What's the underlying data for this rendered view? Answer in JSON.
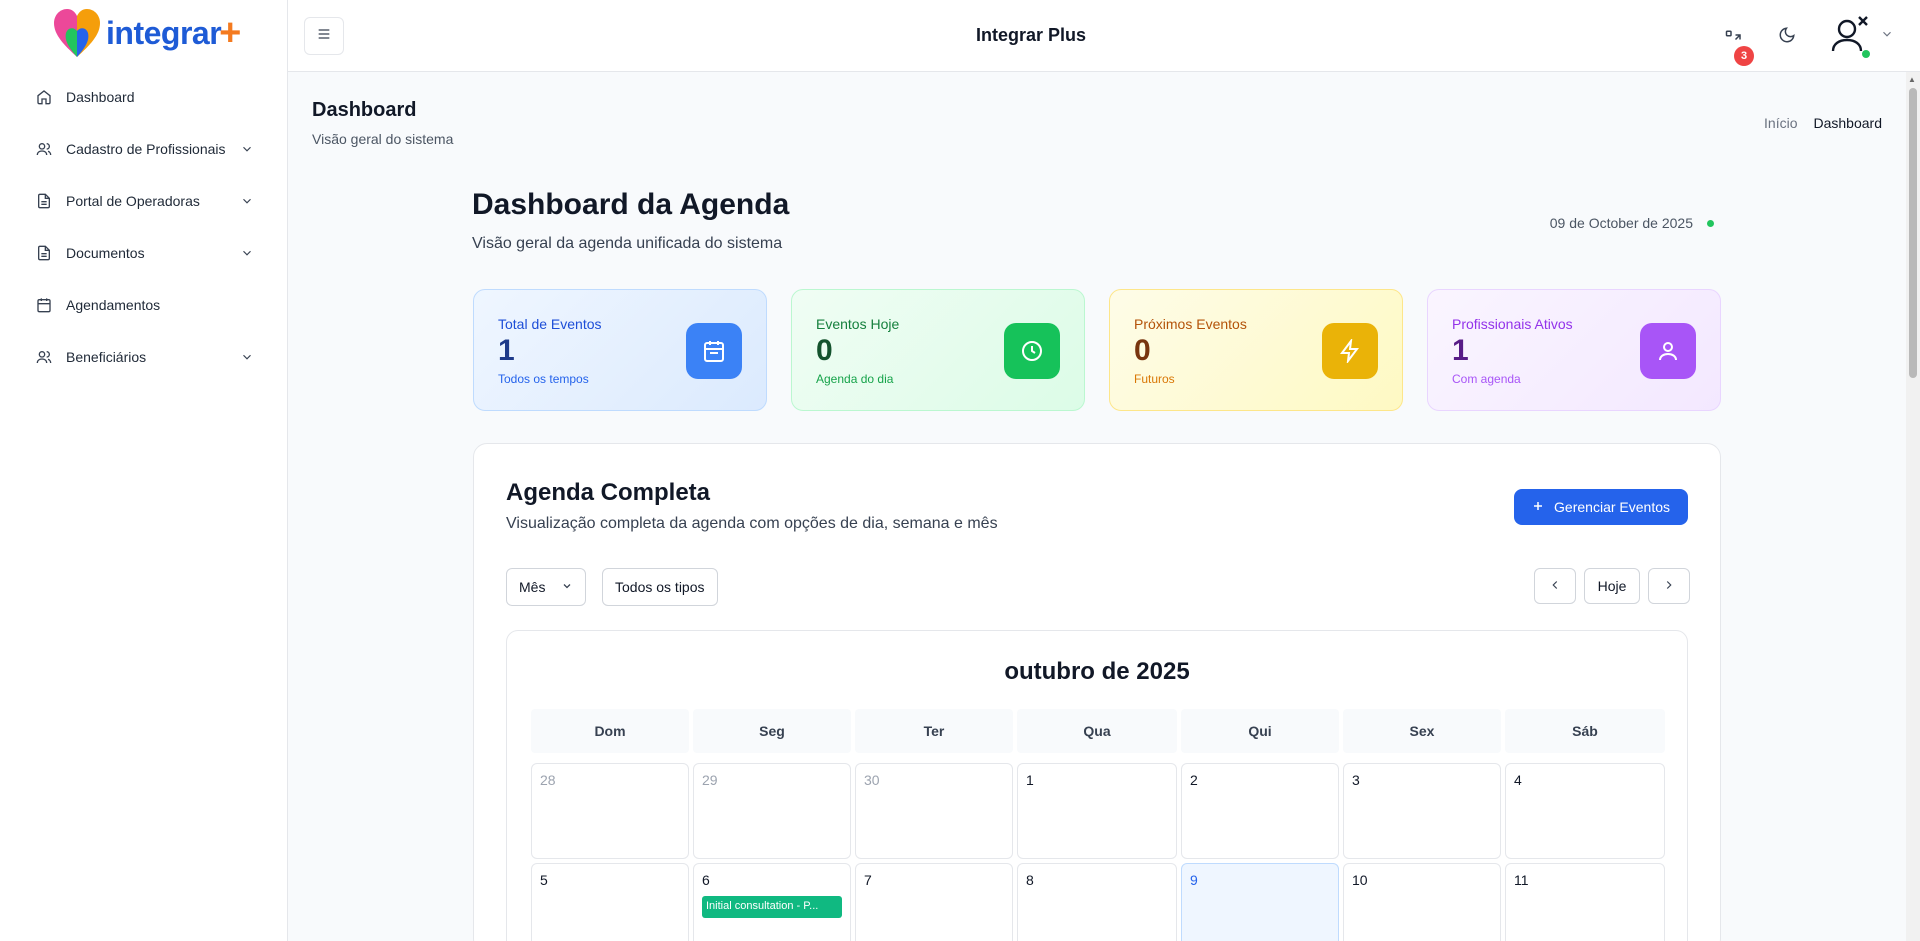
{
  "brand": {
    "name": "integrar",
    "plus": "+"
  },
  "sidebar": {
    "items": [
      {
        "label": "Dashboard",
        "icon": "home-icon",
        "expandable": false
      },
      {
        "label": "Cadastro de Profissionais",
        "icon": "users-icon",
        "expandable": true
      },
      {
        "label": "Portal de Operadoras",
        "icon": "file-icon",
        "expandable": true
      },
      {
        "label": "Documentos",
        "icon": "file-icon",
        "expandable": true
      },
      {
        "label": "Agendamentos",
        "icon": "calendar-icon",
        "expandable": false
      },
      {
        "label": "Beneficiários",
        "icon": "users-icon",
        "expandable": true
      }
    ]
  },
  "topbar": {
    "title": "Integrar Plus",
    "notifications_count": "3"
  },
  "page": {
    "title": "Dashboard",
    "subtitle": "Visão geral do sistema",
    "breadcrumb": [
      "Início",
      "Dashboard"
    ]
  },
  "dashboard": {
    "title": "Dashboard da Agenda",
    "subtitle": "Visão geral da agenda unificada do sistema",
    "date": "09 de October de 2025"
  },
  "stats": [
    {
      "label": "Total de Eventos",
      "value": "1",
      "note": "Todos os tempos",
      "icon": "calendar-icon"
    },
    {
      "label": "Eventos Hoje",
      "value": "0",
      "note": "Agenda do dia",
      "icon": "clock-icon"
    },
    {
      "label": "Próximos Eventos",
      "value": "0",
      "note": "Futuros",
      "icon": "bolt-icon"
    },
    {
      "label": "Profissionais Ativos",
      "value": "1",
      "note": "Com agenda",
      "icon": "user-icon"
    }
  ],
  "agenda": {
    "title": "Agenda Completa",
    "subtitle": "Visualização completa da agenda com opções de dia, semana e mês",
    "manage_button": "Gerenciar Eventos",
    "view_select": "Mês",
    "type_select": "Todos os tipos",
    "today_button": "Hoje"
  },
  "calendar": {
    "month_title": "outubro de 2025",
    "weekdays": [
      "Dom",
      "Seg",
      "Ter",
      "Qua",
      "Qui",
      "Sex",
      "Sáb"
    ],
    "week1": [
      "28",
      "29",
      "30",
      "1",
      "2",
      "3",
      "4"
    ],
    "week2": [
      "5",
      "6",
      "7",
      "8",
      "9",
      "10",
      "11"
    ],
    "event": "Initial consultation - P..."
  }
}
